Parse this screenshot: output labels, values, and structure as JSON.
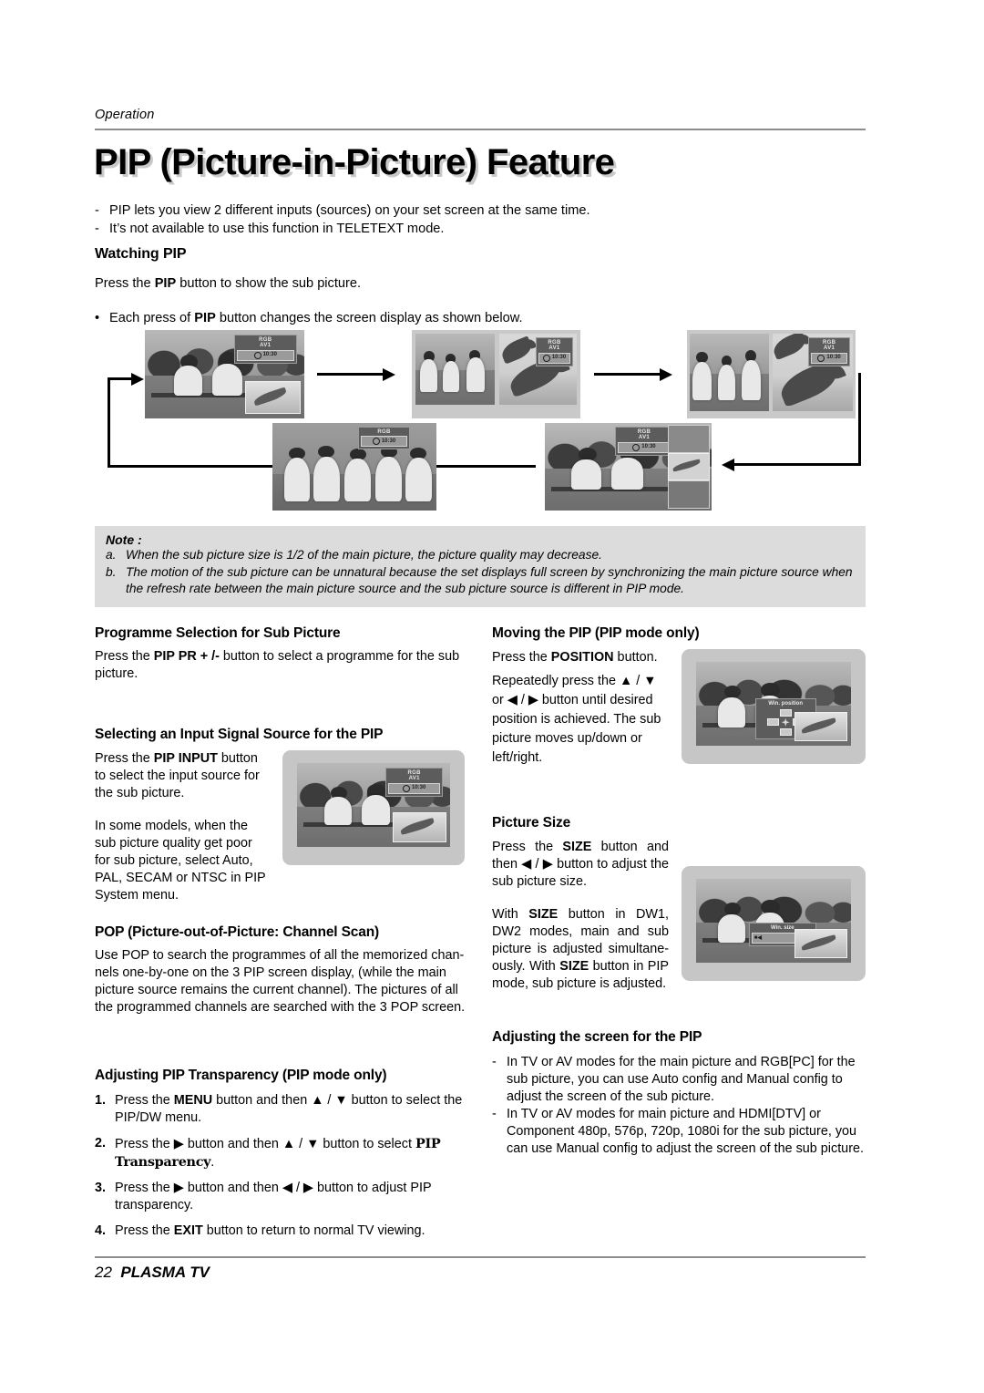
{
  "header": {
    "section_label": "Operation",
    "title": "PIP (Picture-in-Picture) Feature"
  },
  "intro": {
    "bullet_mark": "-",
    "items": [
      "PIP lets you view 2 different inputs (sources) on your set screen at the same time.",
      "It’s not available to use this function in TELETEXT mode."
    ]
  },
  "watching_pip": {
    "heading": "Watching PIP",
    "line1_pre": "Press the ",
    "line1_bold": "PIP",
    "line1_post": " button to show the sub picture.",
    "bullet_mark": "•",
    "line2_pre": "Each press of ",
    "line2_bold": "PIP",
    "line2_post": " button changes the screen display as shown below."
  },
  "osd": {
    "line1": "RGB",
    "line2": "AV1",
    "clock": "10:30",
    "win_position_label": "Win. position",
    "win_size_label": "Win. size"
  },
  "note": {
    "title": "Note :",
    "items": [
      {
        "mark": "a.",
        "text": "When the sub picture size is 1/2 of the main picture, the picture quality may decrease."
      },
      {
        "mark": "b.",
        "text": "The motion of the sub picture can be unnatural because the set displays full screen by synchronizing the main picture source when the refresh rate between the main picture source and the sub picture source is different in PIP mode."
      }
    ]
  },
  "programme_selection": {
    "heading": "Programme Selection for Sub Picture",
    "text_pre": "Press the ",
    "text_bold": "PIP PR + /-",
    "text_post": " button to select a programme for the sub picture."
  },
  "input_signal": {
    "heading": "Selecting an Input Signal Source for the PIP",
    "para1_pre": "Press the ",
    "para1_bold": "PIP INPUT",
    "para1_post": " button to select the input source for the sub picture.",
    "para2": "In some models, when the sub picture quality get poor for sub picture, select Auto, PAL, SECAM or NTSC in PIP System menu."
  },
  "pop": {
    "heading": "POP (Picture-out-of-Picture: Channel Scan)",
    "text": "Use POP to search the programmes of all the memorized chan-nels one-by-one on the 3 PIP screen display, (while the main picture source remains the current channel). The pictures of all the programmed channels are searched with the 3 POP screen."
  },
  "transparency": {
    "heading": "Adjusting PIP Transparency (PIP mode only)",
    "steps": [
      {
        "num": "1.",
        "pre": "Press the ",
        "bold": "MENU",
        "post": " button and then ▲ / ▼ button to select the PIP/DW menu."
      },
      {
        "num": "2.",
        "pre": "Press the ▶ button and then ▲ / ▼ button to select ",
        "bold": "PIP Transparency",
        "post": "."
      },
      {
        "num": "3.",
        "pre": "Press the ▶ button and then ◀ / ▶ button to adjust PIP transparency.",
        "bold": "",
        "post": ""
      },
      {
        "num": "4.",
        "pre": "Press the ",
        "bold": "EXIT",
        "post": " button to return to normal TV viewing."
      }
    ]
  },
  "moving_pip": {
    "heading": "Moving the PIP (PIP mode only)",
    "para1_pre": "Press the ",
    "para1_bold": "POSITION",
    "para1_post": " button.",
    "para2": "Repeatedly press the ▲ / ▼ or ◀ / ▶ button until desired position is achieved. The sub picture moves up/down or left/right."
  },
  "picture_size": {
    "heading": "Picture Size",
    "para1_pre": "Press the ",
    "para1_bold": "SIZE",
    "para1_post": " button and then ◀ / ▶ button to adjust the sub picture size.",
    "para2_a_pre": "With ",
    "para2_a_bold": "SIZE",
    "para2_a_mid": " button in DW1, DW2 modes, main and sub picture is adjusted simultane-ously. With ",
    "para2_b_bold": "SIZE",
    "para2_b_post": " button in PIP mode, sub picture is adjusted."
  },
  "adjusting_screen": {
    "heading": "Adjusting the screen for the PIP",
    "bullet_mark": "-",
    "items": [
      "In TV or AV modes for the main picture and RGB[PC] for the sub picture, you can use Auto config and Manual config to adjust the screen of the sub picture.",
      "In TV or AV modes for main picture and HDMI[DTV] or Component 480p, 576p, 720p, 1080i for the sub picture, you can use Manual config to adjust the screen of the sub picture."
    ]
  },
  "footer": {
    "page_number": "22",
    "product": "PLASMA TV"
  }
}
